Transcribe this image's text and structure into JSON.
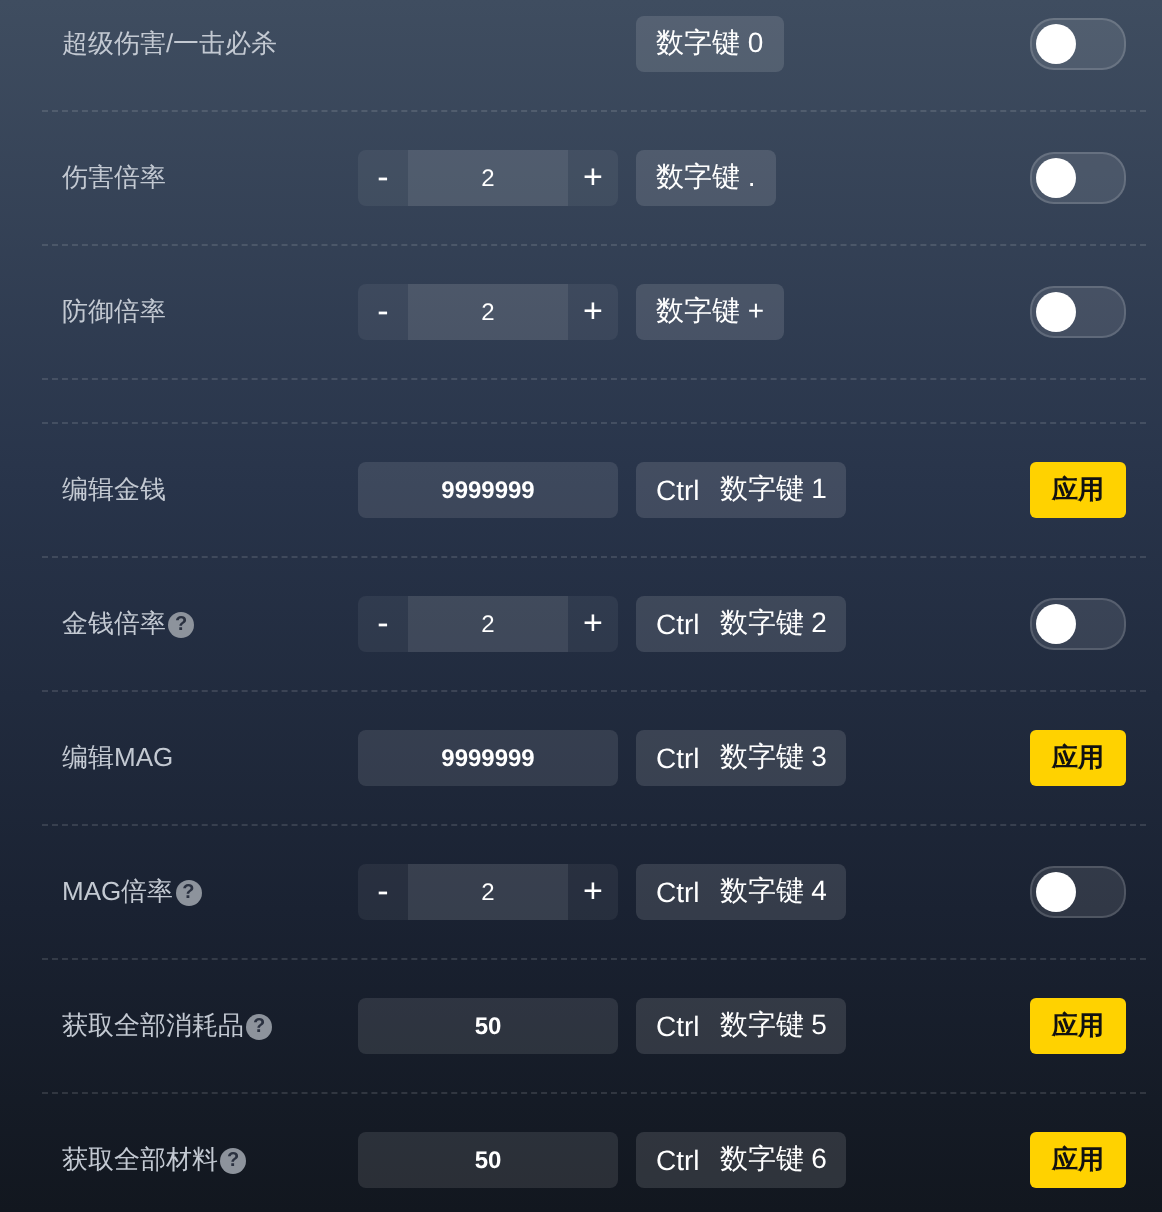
{
  "sections": [
    {
      "rows": [
        {
          "label": "超级伤害/一击必杀",
          "hotkey": [
            "数字键 0"
          ],
          "action": {
            "kind": "toggle",
            "on": false
          }
        },
        {
          "label": "伤害倍率",
          "control": {
            "kind": "stepper",
            "minus": "-",
            "value": "2",
            "plus": "+"
          },
          "hotkey": [
            "数字键 ."
          ],
          "action": {
            "kind": "toggle",
            "on": false
          }
        },
        {
          "label": "防御倍率",
          "control": {
            "kind": "stepper",
            "minus": "-",
            "value": "2",
            "plus": "+"
          },
          "hotkey": [
            "数字键 +"
          ],
          "action": {
            "kind": "toggle",
            "on": false
          }
        }
      ]
    },
    {
      "rows": [
        {
          "label": "编辑金钱",
          "control": {
            "kind": "field",
            "value": "9999999"
          },
          "hotkey": [
            "Ctrl",
            "数字键 1"
          ],
          "action": {
            "kind": "button",
            "label": "应用"
          }
        },
        {
          "label": "金钱倍率",
          "help": "?",
          "control": {
            "kind": "stepper",
            "minus": "-",
            "value": "2",
            "plus": "+"
          },
          "hotkey": [
            "Ctrl",
            "数字键 2"
          ],
          "action": {
            "kind": "toggle",
            "on": false
          }
        },
        {
          "label": "编辑MAG",
          "control": {
            "kind": "field",
            "value": "9999999"
          },
          "hotkey": [
            "Ctrl",
            "数字键 3"
          ],
          "action": {
            "kind": "button",
            "label": "应用"
          }
        },
        {
          "label": "MAG倍率",
          "help": "?",
          "control": {
            "kind": "stepper",
            "minus": "-",
            "value": "2",
            "plus": "+"
          },
          "hotkey": [
            "Ctrl",
            "数字键 4"
          ],
          "action": {
            "kind": "toggle",
            "on": false
          }
        },
        {
          "label": "获取全部消耗品",
          "help": "?",
          "control": {
            "kind": "field",
            "value": "50"
          },
          "hotkey": [
            "Ctrl",
            "数字键 5"
          ],
          "action": {
            "kind": "button",
            "label": "应用"
          }
        },
        {
          "label": "获取全部材料",
          "help": "?",
          "control": {
            "kind": "field",
            "value": "50"
          },
          "hotkey": [
            "Ctrl",
            "数字键 6"
          ],
          "action": {
            "kind": "button",
            "label": "应用"
          }
        }
      ]
    }
  ]
}
